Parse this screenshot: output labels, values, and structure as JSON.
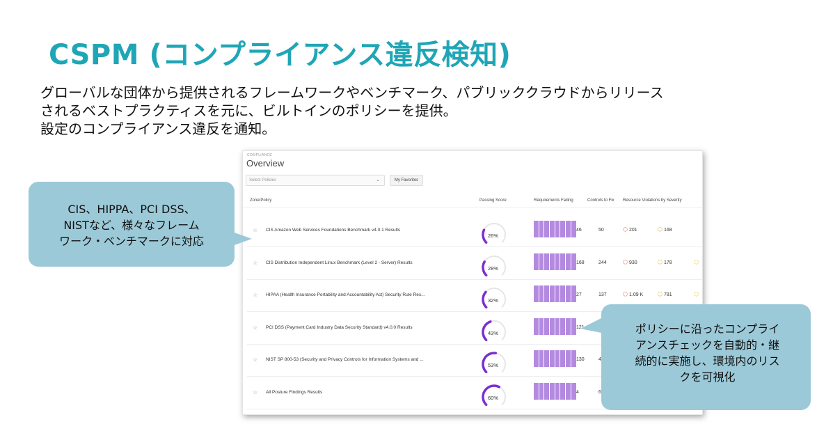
{
  "slide": {
    "title": "CSPM (コンプライアンス違反検知)",
    "description_lines": [
      "グローバルな団体から提供されるフレームワークやベンチマーク、パブリッククラウドからリリース",
      "されるベストプラクティスを元に、ビルトインのポリシーを提供。",
      "設定のコンプライアンス違反を通知。"
    ]
  },
  "app": {
    "breadcrumb": "COMPLIANCE",
    "page_title": "Overview",
    "policy_select_placeholder": "Select Policies",
    "favorites_button": "My Favorites",
    "columns": {
      "zone_policy": "Zone/Policy",
      "passing_score": "Passing Score",
      "requirements_failing": "Requirements Failing",
      "controls_to_fix": "Controls to Fix",
      "resource_violations": "Resource Violations by Severity"
    },
    "rows": [
      {
        "name": "CIS Amazon Web Services Foundations Benchmark v4.0.1 Results",
        "score": "26%",
        "score_value": 26,
        "req_failing": "46",
        "controls_to_fix": "50",
        "high": "201",
        "medium": "168",
        "low_icon": false
      },
      {
        "name": "CIS Distribution Independent Linux Benchmark (Level 2 - Server) Results",
        "score": "28%",
        "score_value": 28,
        "req_failing": "168",
        "controls_to_fix": "244",
        "high": "930",
        "medium": "178",
        "low_icon": true
      },
      {
        "name": "HIPAA (Health Insurance Portability and Accountability Act) Security Rule Res...",
        "score": "32%",
        "score_value": 32,
        "req_failing": "27",
        "controls_to_fix": "137",
        "high": "1.09 K",
        "medium": "781",
        "low_icon": true
      },
      {
        "name": "PCI DSS (Payment Card Industry Data Security Standard) v4.0.0 Results",
        "score": "43%",
        "score_value": 43,
        "req_failing": "121",
        "controls_to_fix": "",
        "high": "",
        "medium": "",
        "low_icon": false
      },
      {
        "name": "NIST SP 800-53 (Security and Privacy Controls for Information Systems and ...",
        "score": "53%",
        "score_value": 53,
        "req_failing": "130",
        "controls_to_fix": "41",
        "high": "",
        "medium": "",
        "low_icon": false
      },
      {
        "name": "All Posture Findings Results",
        "score": "60%",
        "score_value": 60,
        "req_failing": "4",
        "controls_to_fix": "69",
        "high": "",
        "medium": "",
        "low_icon": false
      }
    ]
  },
  "callouts": {
    "left": [
      "CIS、HIPPA、PCI DSS、",
      "NISTなど、様々なフレーム",
      "ワーク・ベンチマークに対応"
    ],
    "right": [
      "ポリシーに沿ったコンプライ",
      "アンスチェックを自動的・継",
      "続的に実施し、環境内のリス",
      "クを可視化"
    ]
  },
  "colors": {
    "title": "#1fa6b6",
    "gauge_fill": "#7a2fd0",
    "gauge_track": "#e6e6e6",
    "requirement_bars": "#b48ae0",
    "callout": "#9cc9d8",
    "severity_high": "#e85f4a",
    "severity_medium": "#e5a42a",
    "severity_low": "#e8c34a"
  },
  "icons": {
    "favorite": "star-outline-icon",
    "select_dropdown": "chevron-down-icon",
    "severity_high": "hexagon-alert-icon",
    "severity_medium": "hexagon-alert-icon",
    "severity_low": "hexagon-alert-icon"
  }
}
